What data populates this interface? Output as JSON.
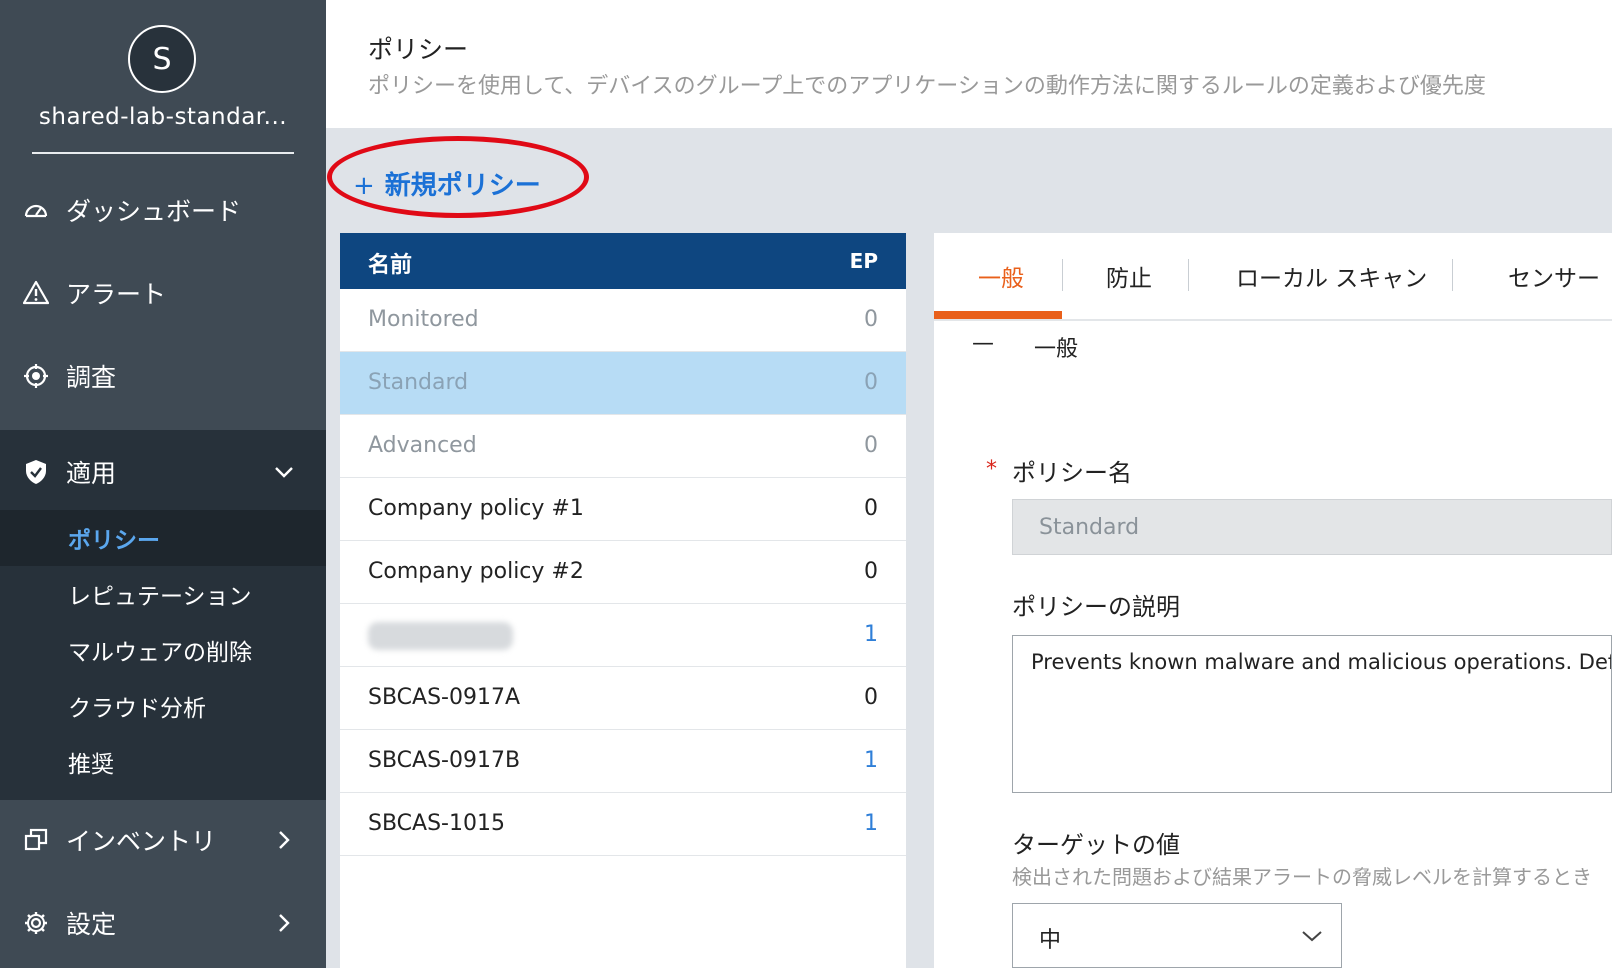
{
  "sidebar": {
    "avatar_letter": "S",
    "org_name": "shared-lab-standar...",
    "nav": {
      "dashboard": "ダッシュボード",
      "alerts": "アラート",
      "investigate": "調査",
      "apply": "適用",
      "inventory": "インベントリ",
      "settings": "設定"
    },
    "apply_sub": {
      "policy": "ポリシー",
      "reputation": "レピュテーション",
      "malware_removal": "マルウェアの削除",
      "cloud_analysis": "クラウド分析",
      "recommendations": "推奨"
    },
    "icons": {
      "dashboard": "gauge-icon",
      "alerts": "warning-triangle-icon",
      "investigate": "crosshair-icon",
      "apply": "shield-check-icon",
      "inventory": "inventory-icon",
      "settings": "gear-icon"
    }
  },
  "header": {
    "title": "ポリシー",
    "description": "ポリシーを使用して、デバイスのグループ上でのアプリケーションの動作方法に関するルールの定義および優先度"
  },
  "new_policy": {
    "plus": "+",
    "label": "新規ポリシー"
  },
  "policy_list": {
    "col_name": "名前",
    "col_ep": "EP",
    "rows": [
      {
        "name": "Monitored",
        "ep": "0"
      },
      {
        "name": "Standard",
        "ep": "0"
      },
      {
        "name": "Advanced",
        "ep": "0"
      },
      {
        "name": "Company policy #1",
        "ep": "0"
      },
      {
        "name": "Company policy #2",
        "ep": "0"
      },
      {
        "name": "",
        "ep": "1"
      },
      {
        "name": "SBCAS-0917A",
        "ep": "0"
      },
      {
        "name": "SBCAS-0917B",
        "ep": "1"
      },
      {
        "name": "SBCAS-1015",
        "ep": "1"
      }
    ]
  },
  "detail": {
    "tabs": {
      "general": "一般",
      "prevention": "防止",
      "local_scan": "ローカル スキャン",
      "sensor": "センサー"
    },
    "section_toggle": "—",
    "section_title": "一般",
    "required_mark": "*",
    "policy_name_label": "ポリシー名",
    "policy_name_value": "Standard",
    "policy_desc_label": "ポリシーの説明",
    "policy_desc_value": "Prevents known malware and malicious operations. Def",
    "target_label": "ターゲットの値",
    "target_help": "検出された問題および結果アラートの脅威レベルを計算するとき",
    "target_value": "中"
  },
  "colors": {
    "sidebar_bg": "#3f4a54",
    "submenu_bg": "#27313a",
    "accent_blue": "#1b71d6",
    "list_header": "#0e4680",
    "selected_row": "#b7dcf5",
    "tab_active": "#e9601b",
    "highlight_ring": "#e00a16"
  }
}
